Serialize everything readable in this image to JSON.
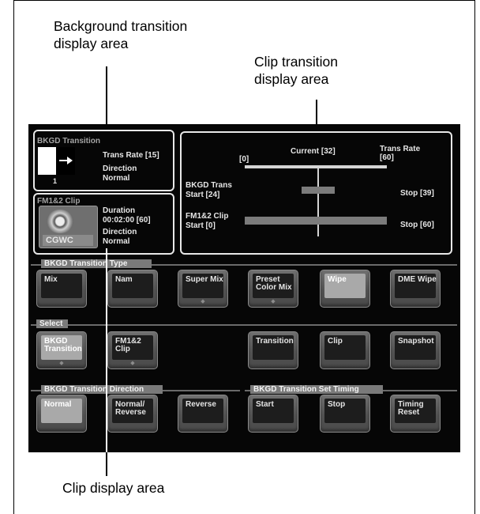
{
  "callouts": {
    "background_transition": "Background transition\ndisplay area",
    "clip_transition": "Clip transition\ndisplay area",
    "clip_display": "Clip display area"
  },
  "bkgd_transition": {
    "title": "BKGD Transition",
    "trans_rate": "Trans Rate [15]",
    "direction_label": "Direction",
    "direction_value": "Normal",
    "pattern_number": "1"
  },
  "clip": {
    "title": "FM1&2 Clip",
    "thumb_label": "CGWC",
    "duration_label": "Duration",
    "duration_value": "00:02:00 [60]",
    "direction_label": "Direction",
    "direction_value": "Normal"
  },
  "timeline": {
    "start_marker": "[0]",
    "current": "Current [32]",
    "trans_rate_label": "Trans Rate",
    "trans_rate_value": "[60]",
    "bkgd_label": "BKGD Trans",
    "bkgd_start": "Start [24]",
    "bkgd_stop": "Stop [39]",
    "clip_label": "FM1&2 Clip",
    "clip_start": "Start [0]",
    "clip_stop": "Stop [60]",
    "scale_max": 60,
    "current_value": 32,
    "bkgd_range": [
      24,
      39
    ],
    "clip_range": [
      0,
      60
    ]
  },
  "sections": {
    "type": "BKGD Transition Type",
    "select": "Select",
    "direction": "BKGD Transition Direction",
    "timing": "BKGD Transition Set Timing"
  },
  "buttons": {
    "mix": "Mix",
    "nam": "Nam",
    "super_mix": "Super Mix",
    "preset_color_mix": "Preset\nColor Mix",
    "wipe": "Wipe",
    "dme_wipe": "DME Wipe",
    "bkgd_transition": "BKGD\nTransition",
    "fm12_clip": "FM1&2\nClip",
    "transition": "Transition",
    "clip": "Clip",
    "snapshot": "Snapshot",
    "normal": "Normal",
    "normal_reverse": "Normal/\nReverse",
    "reverse": "Reverse",
    "start": "Start",
    "stop": "Stop",
    "timing_reset": "Timing\nReset"
  },
  "colors": {
    "panel_bg": "#060606",
    "lit_button": "#a9a9a9",
    "bar": "#d4d4d4"
  }
}
